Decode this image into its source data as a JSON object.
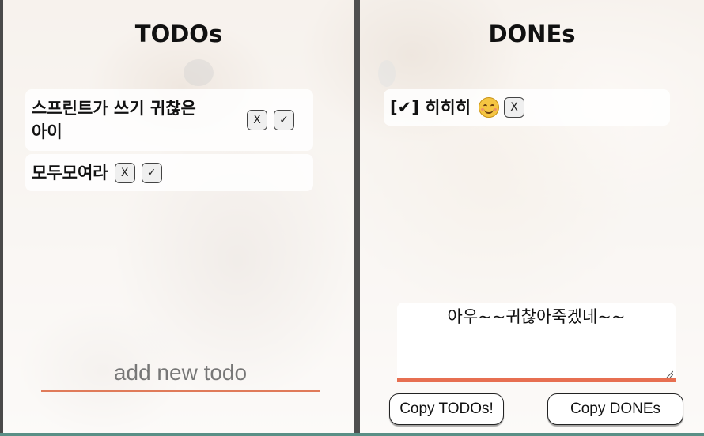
{
  "todos_panel": {
    "title": "TODOs",
    "items": [
      {
        "text_line1": "스프린트가 쓰기 귀찮은",
        "text_line2": "아이",
        "delete_label": "X",
        "done_label": "✓"
      },
      {
        "text": "모두모여라",
        "delete_label": "X",
        "done_label": "✓"
      }
    ],
    "new_todo": {
      "placeholder": "add new todo",
      "value": ""
    }
  },
  "dones_panel": {
    "title": "DONEs",
    "items": [
      {
        "text": "[✔] 히히히",
        "emoji": "smiling-face-icon",
        "delete_label": "X"
      }
    ],
    "note": {
      "value": "아우~~귀찮아죽겠네~~"
    },
    "copy_todos_label": "Copy TODOs!",
    "copy_dones_label": "Copy DONEs"
  },
  "colors": {
    "accent_underline": "#e07b5a",
    "divider": "#4f4f4f"
  }
}
